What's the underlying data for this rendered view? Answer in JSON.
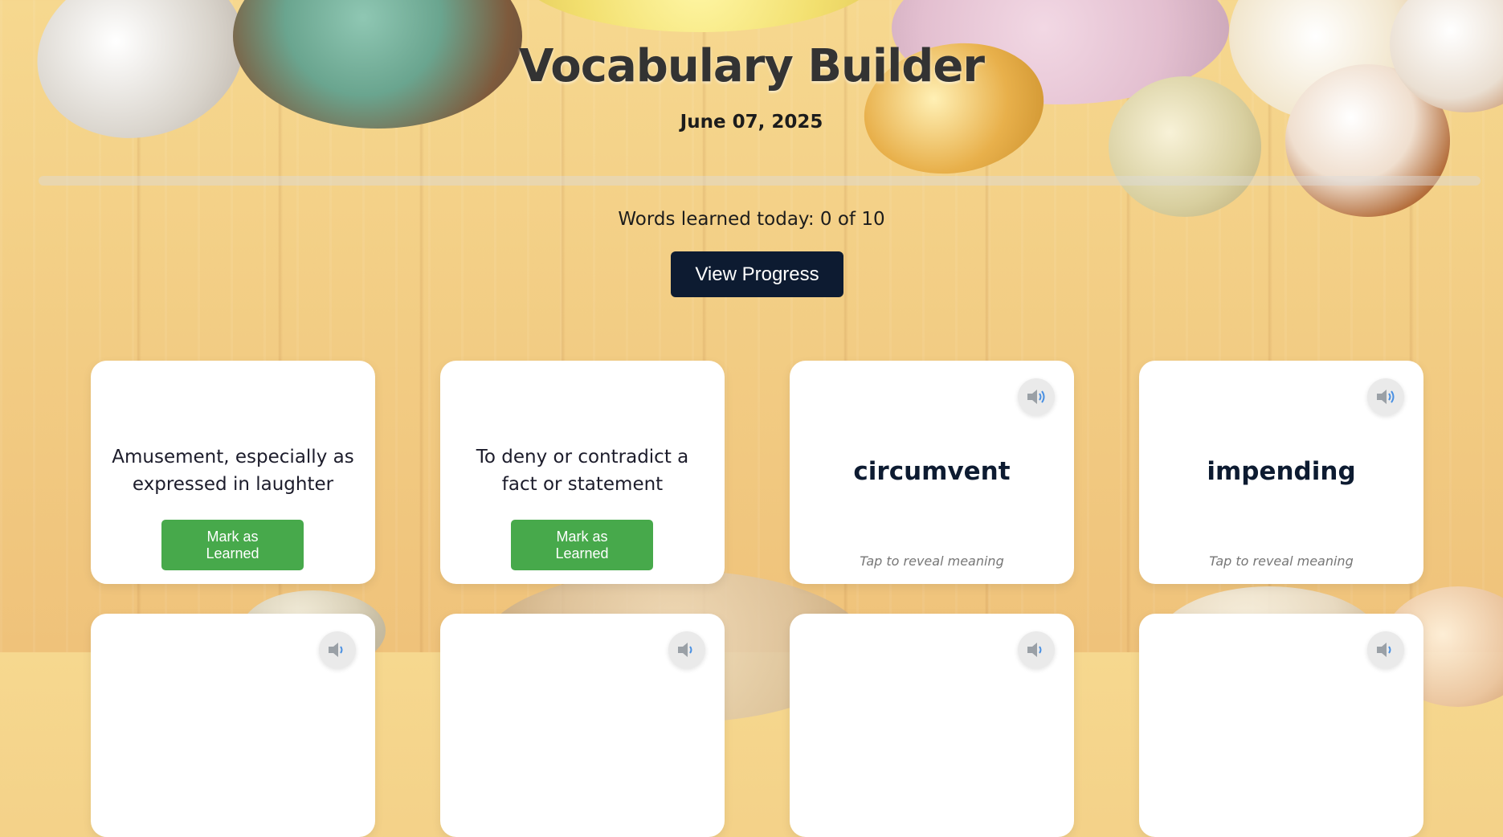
{
  "header": {
    "title": "Vocabulary Builder",
    "date": "June 07, 2025"
  },
  "progress": {
    "text": "Words learned today: 0 of 10",
    "button_label": "View Progress",
    "learned": 0,
    "total": 10
  },
  "colors": {
    "primary_button": "#0d1b31",
    "learned_button": "#47a94b",
    "card_bg": "#ffffff"
  },
  "cards": [
    {
      "meaning": "Amusement, especially as expressed in laughter",
      "button_label": "Mark as Learned"
    },
    {
      "meaning": "To deny or contradict a fact or statement",
      "button_label": "Mark as Learned"
    },
    {
      "word": "circumvent",
      "hint": "Tap to reveal meaning",
      "icon": "speaker-icon"
    },
    {
      "word": "impending",
      "hint": "Tap to reveal meaning",
      "icon": "speaker-icon"
    }
  ],
  "second_row_icons": [
    "speaker-icon",
    "speaker-icon",
    "speaker-icon",
    "speaker-icon"
  ]
}
